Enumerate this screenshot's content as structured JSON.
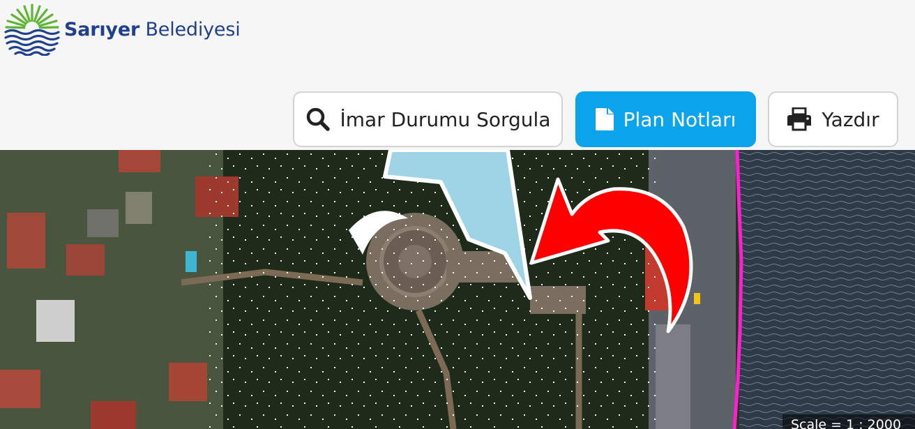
{
  "brand": {
    "name_bold": "Sarıyer",
    "name_rest": "Belediyesi"
  },
  "toolbar": {
    "query_label": "İmar Durumu Sorgula",
    "plan_notes_label": "Plan Notları",
    "print_label": "Yazdır"
  },
  "map": {
    "scale_text": "Scale = 1 : 2000"
  },
  "colors": {
    "primary": "#0aa3ec",
    "brand_blue": "#1f3f8f",
    "brand_green": "#5cb534",
    "boundary": "#ff1fd0",
    "arrow": "#ff0000",
    "parcel": "#9fd3e6"
  },
  "icons": [
    "search-icon",
    "document-icon",
    "printer-icon",
    "arrow-annotation"
  ]
}
